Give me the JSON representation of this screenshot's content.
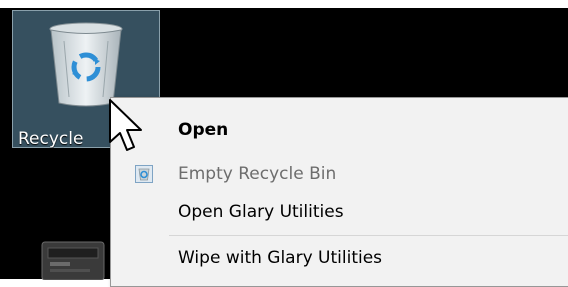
{
  "desktop": {
    "recycle_bin_label": "Recycle"
  },
  "context_menu": {
    "items": [
      {
        "label": "Open",
        "style": "bold",
        "enabled": true
      },
      {
        "label": "Empty Recycle Bin",
        "style": "normal",
        "enabled": false,
        "icon": "recycle-bin-icon"
      },
      {
        "label": "Open Glary Utilities",
        "style": "normal",
        "enabled": true
      },
      {
        "label": "Wipe with Glary Utilities",
        "style": "normal",
        "enabled": true
      }
    ]
  },
  "colors": {
    "desktop_background": "#000000",
    "selected_icon_background": "#36505f",
    "menu_background": "#f2f2f2",
    "disabled_text": "#6d6d6d"
  }
}
